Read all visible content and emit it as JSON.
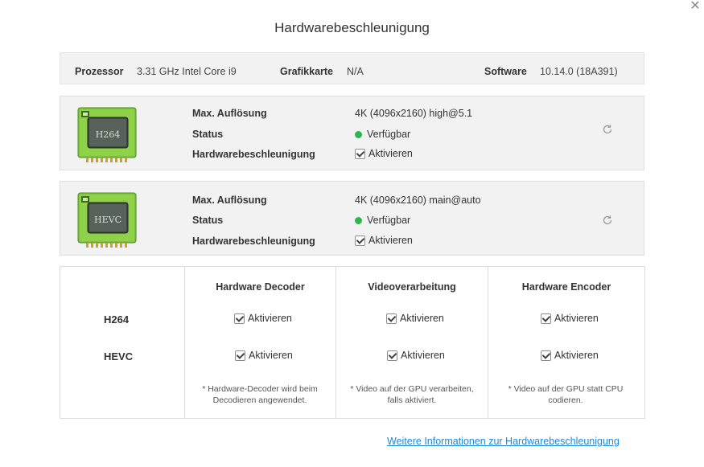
{
  "dialog": {
    "title": "Hardwarebeschleunigung"
  },
  "system": {
    "processor_label": "Prozessor",
    "processor_value": "3.31 GHz Intel Core i9",
    "gpu_label": "Grafikkarte",
    "gpu_value": "N/A",
    "software_label": "Software",
    "software_value": "10.14.0 (18A391)"
  },
  "codecs": [
    {
      "name": "H264",
      "max_res_label": "Max. Auflösung",
      "max_res_value": "4K (4096x2160) high@5.1",
      "status_label": "Status",
      "status_value": "Verfügbar",
      "accel_label": "Hardwarebeschleunigung",
      "accel_value": "Aktivieren",
      "status_color": "#2cb84b"
    },
    {
      "name": "HEVC",
      "max_res_label": "Max. Auflösung",
      "max_res_value": "4K (4096x2160) main@auto",
      "status_label": "Status",
      "status_value": "Verfügbar",
      "accel_label": "Hardwarebeschleunigung",
      "accel_value": "Aktivieren",
      "status_color": "#2cb84b"
    }
  ],
  "table": {
    "columns": [
      "Hardware Decoder",
      "Videoverarbeitung",
      "Hardware Encoder"
    ],
    "rows": [
      "H264",
      "HEVC"
    ],
    "cell_label": "Aktivieren",
    "notes": [
      "* Hardware-Decoder wird beim Decodieren angewendet.",
      "* Video auf der GPU verarbeiten, falls aktiviert.",
      "* Video auf der GPU statt CPU codieren."
    ]
  },
  "link": {
    "text": "Weitere Informationen zur Hardwarebeschleunigung"
  },
  "colors": {
    "accent": "#1e88d8",
    "available": "#2cb84b",
    "panel": "#f2f2f2"
  }
}
